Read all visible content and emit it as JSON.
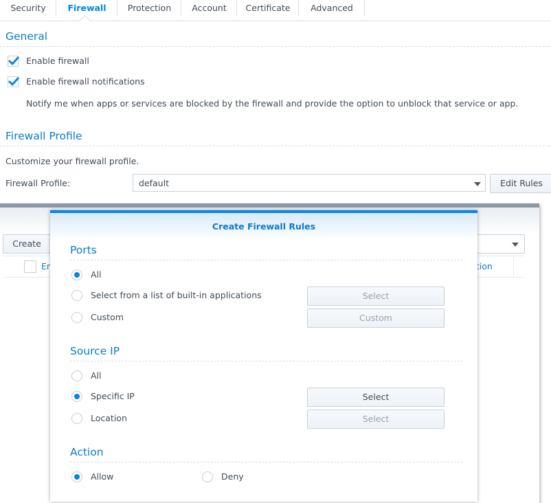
{
  "tabs": [
    {
      "label": "Security",
      "active": false
    },
    {
      "label": "Firewall",
      "active": true
    },
    {
      "label": "Protection",
      "active": false
    },
    {
      "label": "Account",
      "active": false
    },
    {
      "label": "Certificate",
      "active": false
    },
    {
      "label": "Advanced",
      "active": false
    }
  ],
  "general": {
    "title": "General",
    "enable_firewall": {
      "label": "Enable firewall",
      "checked": true
    },
    "enable_notifications": {
      "label": "Enable firewall notifications",
      "checked": true
    },
    "notify_description": "Notify me when apps or services are blocked by the firewall and provide the option to unblock that service or app."
  },
  "profile": {
    "title": "Firewall Profile",
    "description": "Customize your firewall profile.",
    "field_label": "Firewall Profile:",
    "selected": "default",
    "edit_rules_label": "Edit Rules"
  },
  "rules_window": {
    "create_label": "Create",
    "col_enabled_partial": "En",
    "col_action_partial": "ction"
  },
  "dialog": {
    "title": "Create Firewall Rules",
    "ports": {
      "title": "Ports",
      "options": [
        "All",
        "Select from a list of built-in applications",
        "Custom"
      ],
      "selected": "All",
      "select_button": "Select",
      "custom_button": "Custom"
    },
    "source_ip": {
      "title": "Source IP",
      "options": [
        "All",
        "Specific IP",
        "Location"
      ],
      "selected": "Specific IP",
      "specific_select_button": "Select",
      "location_select_button": "Select"
    },
    "action": {
      "title": "Action",
      "options": [
        "Allow",
        "Deny"
      ],
      "selected": "Allow"
    }
  },
  "colors": {
    "accent": "#0086e5",
    "heading": "#0a7ad1",
    "text": "#414b55"
  }
}
